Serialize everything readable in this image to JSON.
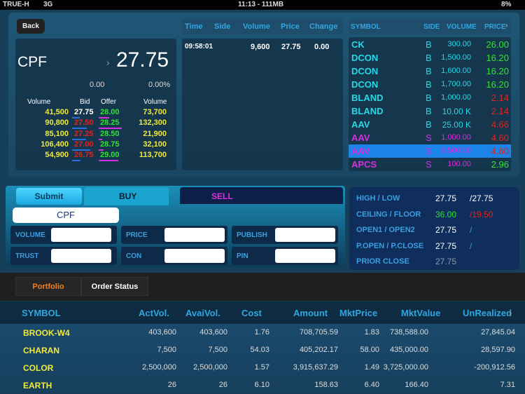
{
  "status_bar": {
    "carrier": "TRUE-H",
    "network": "3G",
    "time": "11:13 - 111MB",
    "battery": "8%"
  },
  "back_label": "Back",
  "quote": {
    "symbol": "CPF",
    "last": "27.75",
    "change": "0.00",
    "pct_change": "0.00%",
    "headers": [
      "Volume",
      "Bid",
      "Offer",
      "Volume"
    ],
    "rows": [
      {
        "bid_vol": "41,500",
        "bid": "27.75",
        "bid_color": "#ffffff",
        "offer": "28.00",
        "offer_vol": "73,700",
        "bid_bar": 0.35,
        "offer_bar": 0.45
      },
      {
        "bid_vol": "90,800",
        "bid": "27.50",
        "bid_color": "#e0241f",
        "offer": "28.25",
        "offer_vol": "132,300",
        "bid_bar": 0.7,
        "offer_bar": 1.0
      },
      {
        "bid_vol": "85,100",
        "bid": "27.25",
        "bid_color": "#e0241f",
        "offer": "28.50",
        "offer_vol": "21,900",
        "bid_bar": 0.65,
        "offer_bar": 0.15
      },
      {
        "bid_vol": "106,400",
        "bid": "27.00",
        "bid_color": "#e0241f",
        "offer": "28.75",
        "offer_vol": "32,100",
        "bid_bar": 0.85,
        "offer_bar": 0.2
      },
      {
        "bid_vol": "54,900",
        "bid": "26.75",
        "bid_color": "#e0241f",
        "offer": "29.00",
        "offer_vol": "113,700",
        "bid_bar": 0.4,
        "offer_bar": 0.85
      }
    ]
  },
  "ticks": {
    "headers": [
      "Time",
      "Side",
      "Volume",
      "Price",
      "Change"
    ],
    "rows": [
      {
        "time": "09:58:01",
        "volume": "9,600",
        "price": "27.75",
        "change": "0.00"
      }
    ]
  },
  "market": {
    "headers": [
      "SYMBOL",
      "SIDE",
      "VOLUME",
      "PRICE"
    ],
    "rows": [
      {
        "symbol": "CK",
        "side": "B",
        "volume": "300.00",
        "price": "26.00",
        "price_color": "#2ee52e"
      },
      {
        "symbol": "DCON",
        "side": "B",
        "volume": "1,500.00",
        "price": "16.20",
        "price_color": "#2ee52e"
      },
      {
        "symbol": "DCON",
        "side": "B",
        "volume": "1,600.00",
        "price": "16.20",
        "price_color": "#2ee52e"
      },
      {
        "symbol": "DCON",
        "side": "B",
        "volume": "1,700.00",
        "price": "16.20",
        "price_color": "#2ee52e"
      },
      {
        "symbol": "BLAND",
        "side": "B",
        "volume": "1,000.00",
        "price": "2.14",
        "price_color": "#e0241f"
      },
      {
        "symbol": "BLAND",
        "side": "B",
        "volume": "10.00 K",
        "price": "2.14",
        "price_color": "#e0241f"
      },
      {
        "symbol": "AAV",
        "side": "B",
        "volume": "25.00 K",
        "price": "4.66",
        "price_color": "#e0241f"
      },
      {
        "symbol": "AAV",
        "side": "S",
        "volume": "1,000.00",
        "price": "4.60",
        "price_color": "#e0241f"
      },
      {
        "symbol": "AAV",
        "side": "S",
        "volume": "9,500.00",
        "price": "4.60",
        "price_color": "#e0241f",
        "selected": true
      },
      {
        "symbol": "APCS",
        "side": "S",
        "volume": "100.00",
        "price": "2.96",
        "price_color": "#2ee52e"
      }
    ]
  },
  "order": {
    "submit": "Submit",
    "buy": "BUY",
    "sell": "SELL",
    "symbol": "CPF",
    "fields": [
      "VOLUME",
      "PRICE",
      "PUBLISH",
      "TRUST",
      "CON",
      "PIN"
    ]
  },
  "info": {
    "rows": [
      {
        "label": "HIGH / LOW",
        "v1": "27.75",
        "v2": "/27.75",
        "c1": "#ffffff",
        "c2": "#ffffff"
      },
      {
        "label": "CEILING / FLOOR",
        "v1": "36.00",
        "v2": "/19.50",
        "c1": "#2ee52e",
        "c2": "#e0241f"
      },
      {
        "label": "OPEN1 / OPEN2",
        "v1": "27.75",
        "v2": "/",
        "c1": "#ffffff",
        "c2": "#3a9ee0"
      },
      {
        "label": "P.OPEN / P.CLOSE",
        "v1": "27.75",
        "v2": "/",
        "c1": "#ffffff",
        "c2": "#3a9ee0"
      },
      {
        "label": "PRIOR CLOSE",
        "v1": "27.75",
        "v2": "",
        "c1": "#8a9aa8",
        "c2": "#fff"
      }
    ]
  },
  "tabs": {
    "portfolio": "Portfolio",
    "order_status": "Order Status"
  },
  "portfolio": {
    "headers": [
      "SYMBOL",
      "ActVol.",
      "AvaiVol.",
      "Cost",
      "Amount",
      "MktPrice",
      "MktValue",
      "UnRealized"
    ],
    "rows": [
      [
        "BROOK-W4",
        "403,600",
        "403,600",
        "1.76",
        "708,705.59",
        "1.83",
        "738,588.00",
        "27,845.04"
      ],
      [
        "CHARAN",
        "7,500",
        "7,500",
        "54.03",
        "405,202.17",
        "58.00",
        "435,000.00",
        "28,597.90"
      ],
      [
        "COLOR",
        "2,500,000",
        "2,500,000",
        "1.57",
        "3,915,637.29",
        "1.49",
        "3,725,000.00",
        "-200,912.56"
      ],
      [
        "EARTH",
        "26",
        "26",
        "6.10",
        "158.63",
        "6.40",
        "166.40",
        "7.31"
      ]
    ]
  }
}
